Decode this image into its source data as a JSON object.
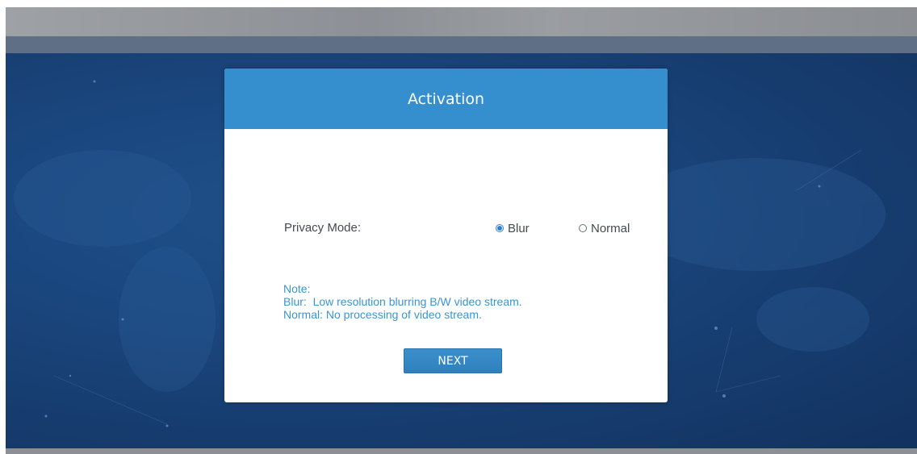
{
  "dialog": {
    "title": "Activation"
  },
  "privacy": {
    "label": "Privacy Mode:",
    "options": [
      {
        "label": "Blur",
        "selected": true
      },
      {
        "label": "Normal",
        "selected": false
      }
    ]
  },
  "note": {
    "heading": "Note:",
    "lines": [
      "Blur:  Low resolution blurring B/W video stream.",
      "Normal: No processing of video stream."
    ]
  },
  "actions": {
    "next_label": "NEXT"
  },
  "colors": {
    "header": "#358fcf",
    "note_text": "#3a95d2",
    "background": "#1a467e"
  }
}
